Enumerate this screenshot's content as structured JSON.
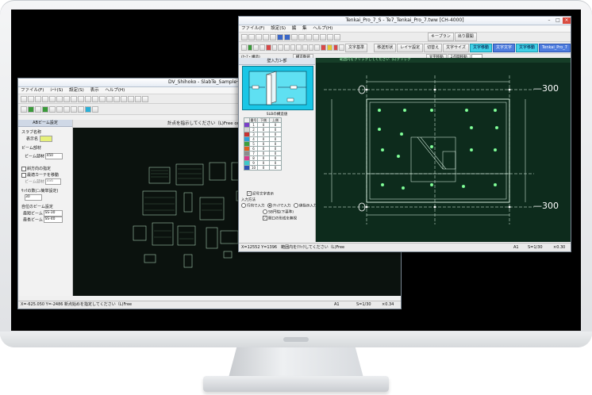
{
  "back_window": {
    "title": "DV_Shihoko - SlabTe_Sample一般文",
    "menu": [
      "ファイル(F)",
      "ｼｰﾄ(S)",
      "設定(S)",
      "表示",
      "ヘルプ(H)"
    ],
    "banner": "計点を指示してください（L)Free or Read（R)Read　[AT形]　[50:2]",
    "panel": {
      "header": "ABビーム設定",
      "slab_label": "スラブ名称",
      "slab_sub": "表示名",
      "beam_section": "ビーム部材",
      "beam_label": "ビーム部材",
      "beam_value": "450",
      "opt1": "斜方向の指定",
      "opt2": "最適カーテを移動",
      "beam_type_label": "ビーム部材",
      "beam_type_value": "SS6",
      "layout_label": "ｻｯｸの数(ﾆｭ簡単設定)",
      "layout_value": "30",
      "self_label": "自位のビーム設定",
      "top_label": "最短ビーム",
      "top_value": "SS-30",
      "bottom_label": "最長ビーム",
      "bottom_value": "SS-40"
    },
    "status": {
      "coords": "X=-625.050 Y=-2486 新点始めを指定してください（L)Free",
      "sheet": "A1",
      "scale": "S=1/30",
      "zoom": "×0.34"
    }
  },
  "front_window": {
    "title": "Tenkai_Pro_7_S - Te7_Tenkai_Pro_7.tww [CH-4000]",
    "menu": [
      "ファイル(F)",
      "設定(S)",
      "編",
      "集",
      "ヘルプ(H)"
    ],
    "toolbar_texts": [
      "キープラン",
      "出り展開",
      "文字基準",
      "移送形状",
      "レイヤ設定",
      "切替え",
      "文字サイズ",
      "文字移動",
      "文字文字",
      "文字移動",
      "2点間移動",
      "移動数値",
      "Tenkai_Pro_7"
    ],
    "toolbar_row3_left": "(ｹｰｱ・構造)",
    "toolbar_row3_mid": "構造数値",
    "panel": {
      "header": "壁入力ｺｰ部",
      "table_title": "SLBの構造値",
      "col_headers": [
        "番号",
        "下側",
        "上側"
      ],
      "rows": [
        {
          "no": "1",
          "a": "0",
          "b": "0"
        },
        {
          "no": "2",
          "a": "0",
          "b": "0"
        },
        {
          "no": "3",
          "a": "0",
          "b": "0"
        },
        {
          "no": "4",
          "a": "0",
          "b": "0"
        },
        {
          "no": "5",
          "a": "0",
          "b": "0"
        },
        {
          "no": "6",
          "a": "0",
          "b": "0"
        },
        {
          "no": "7",
          "a": "0",
          "b": "0"
        },
        {
          "no": "8",
          "a": "0",
          "b": "0"
        },
        {
          "no": "9",
          "a": "0",
          "b": "0"
        },
        {
          "no": "10",
          "a": "0",
          "b": "0"
        }
      ],
      "row_colors": [
        "#7a3fc8",
        "#d3d3d3",
        "#c83232",
        "#2da1d8",
        "#3ca03c",
        "#e06020",
        "#8c8c8c",
        "#d83c8c",
        "#3cc8c8",
        "#2d4fb4"
      ],
      "chk_show": "記号文字表示",
      "input_label": "入力方法",
      "radio1": "行向で入力",
      "radio2": "ｸﾘｯｸで入力",
      "radio3": "値指示入力",
      "radio4": "SB円柱(下基準)",
      "chk_bottom": "開口の形成を無視"
    },
    "banner": "範囲内をクリックしてください（L)クリック",
    "dim_label_top": "300",
    "dim_label_bottom": "300",
    "status": {
      "coords": "X=12552 Y=1396　範囲内をｸﾘｯｸしてください（L)Free",
      "sheet": "A1",
      "scale": "S=1/30",
      "zoom": "×0.30"
    }
  },
  "colors": {
    "back_canvas": "#0b120e",
    "front_canvas": "#0d2b1c",
    "drawing_line": "#c8ffd8",
    "slab_cyan": "#1fd6ee"
  }
}
